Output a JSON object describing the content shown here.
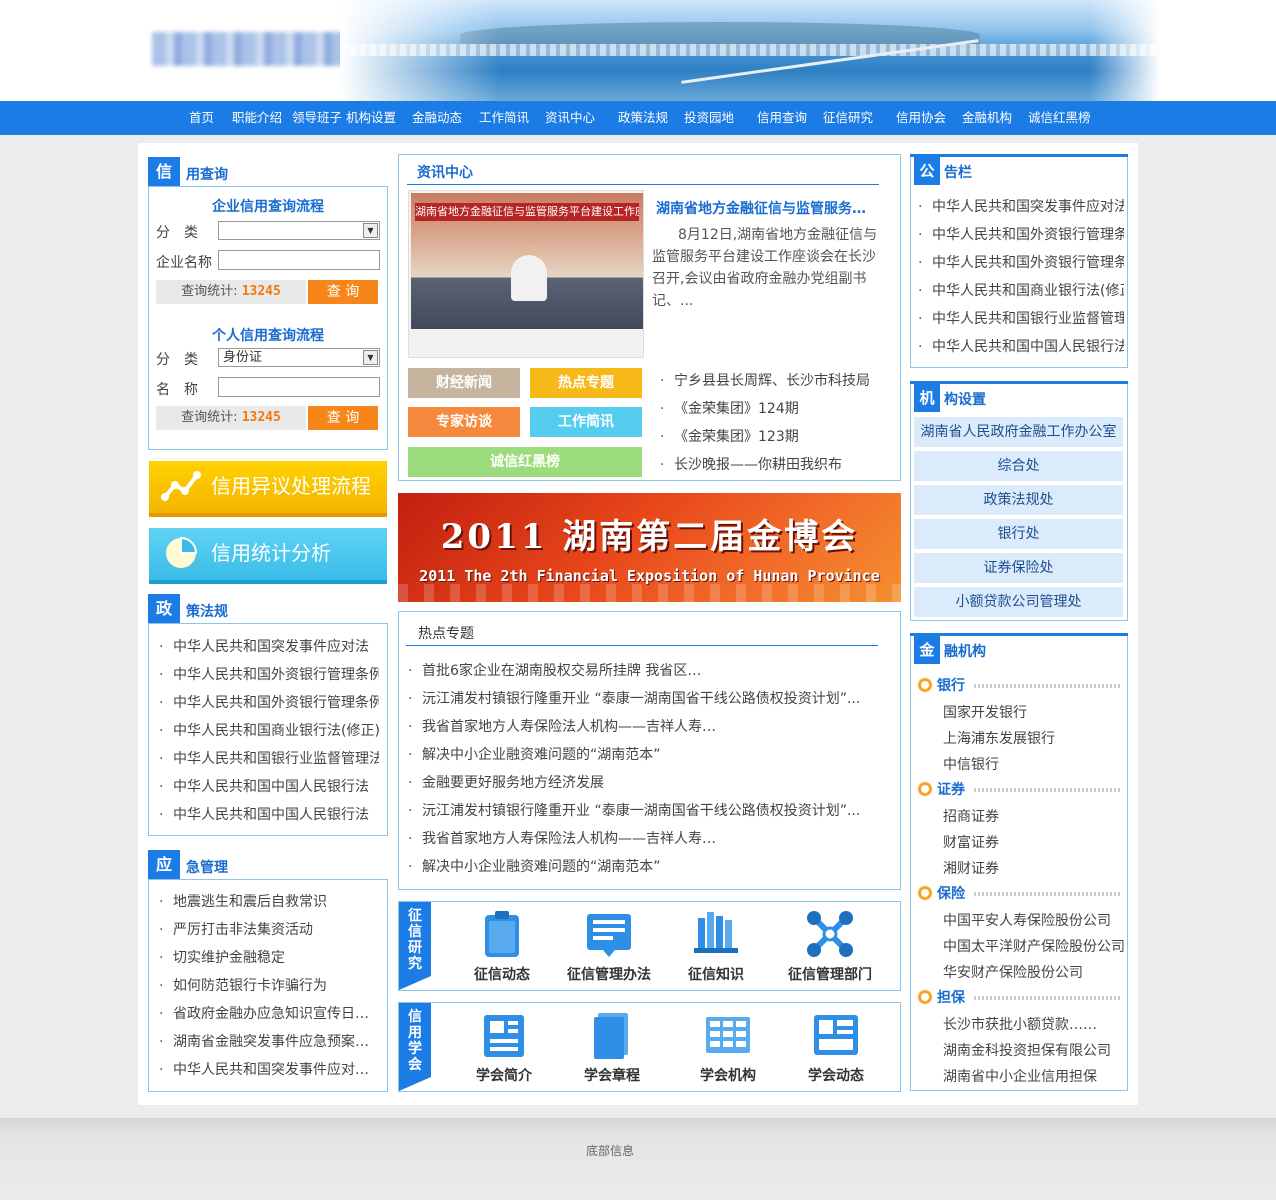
{
  "nav": [
    "首页",
    "职能介绍",
    "领导班子",
    "机构设置",
    "金融动态",
    "工作简讯",
    "资讯中心",
    "政策法规",
    "投资园地",
    "信用查询",
    "征信研究",
    "信用协会",
    "金融机构",
    "诚信红黑榜"
  ],
  "credit_query": {
    "title_first": "信",
    "title_rest": "用查询",
    "enterprise": {
      "title": "企业信用查询流程",
      "category_label": "分　类",
      "category_value": "",
      "name_label": "企业名称",
      "stat_label": "查询统计:",
      "stat_value": "13245",
      "button": "查 询"
    },
    "personal": {
      "title": "个人信用查询流程",
      "category_label": "分　类",
      "category_value": "身份证",
      "name_label": "名　称",
      "stat_label": "查询统计:",
      "stat_value": "13245",
      "button": "查 询"
    }
  },
  "big_buttons": {
    "dispute": "信用异议处理流程",
    "stats": "信用统计分析"
  },
  "policy": {
    "title_first": "政",
    "title_rest": "策法规",
    "items": [
      "中华人民共和国突发事件应对法",
      "中华人民共和国外资银行管理条例",
      "中华人民共和国外资银行管理条例",
      "中华人民共和国商业银行法(修正)",
      "中华人民共和国银行业监督管理法",
      "中华人民共和国中国人民银行法",
      "中华人民共和国中国人民银行法"
    ]
  },
  "emergency": {
    "title_first": "应",
    "title_rest": "急管理",
    "items": [
      "地震逃生和震后自救常识",
      "严厉打击非法集资活动",
      "切实维护金融稳定",
      "如何防范银行卡诈骗行为",
      "省政府金融办应急知识宣传日…",
      "湖南省金融突发事件应急预案…",
      "中华人民共和国突发事件应对…"
    ]
  },
  "news_center": {
    "tab": "资讯中心",
    "image_banner": "湖南省地方金融征信与监管服务平台建设工作座谈会",
    "headline": "湖南省地方金融征信与监管服务…",
    "summary": "8月12日,湖南省地方金融征信与监管服务平台建设工作座谈会在长沙召开,会议由省政府金融办党组副书记、...",
    "tags": [
      "财经新闻",
      "热点专题",
      "专家访谈",
      "工作简讯",
      "诚信红黑榜"
    ],
    "list": [
      "宁乡县县长周辉、长沙市科技局",
      "《金荣集团》124期",
      "《金荣集团》123期",
      "长沙晚报——你耕田我织布"
    ]
  },
  "expo": {
    "title": "2011 湖南第二届金博会",
    "subtitle": "2011 The 2th Financial Exposition of Hunan Province"
  },
  "hot_topics": {
    "tab": "热点专题",
    "items": [
      "首批6家企业在湖南股权交易所挂牌 我省区…",
      "沅江浦发村镇银行隆重开业 “泰康一湖南国省干线公路债权投资计划”...",
      "我省首家地方人寿保险法人机构——吉祥人寿…",
      "解决中小企业融资难问题的“湖南范本”",
      "金融要更好服务地方经济发展",
      "沅江浦发村镇银行隆重开业 “泰康一湖南国省干线公路债权投资计划”...",
      "我省首家地方人寿保险法人机构——吉祥人寿…",
      "解决中小企业融资难问题的“湖南范本”"
    ]
  },
  "credit_research": {
    "label": "征信研究",
    "items": [
      "征信动态",
      "征信管理办法",
      "征信知识",
      "征信管理部门"
    ]
  },
  "credit_assoc": {
    "label": "信用学会",
    "items": [
      "学会简介",
      "学会章程",
      "学会机构",
      "学会动态"
    ]
  },
  "bulletin": {
    "title_first": "公",
    "title_rest": "告栏",
    "items": [
      "中华人民共和国突发事件应对法",
      "中华人民共和国外资银行管理条例",
      "中华人民共和国外资银行管理条例",
      "中华人民共和国商业银行法(修正)",
      "中华人民共和国银行业监督管理法",
      "中华人民共和国中国人民银行法"
    ]
  },
  "org": {
    "title_first": "机",
    "title_rest": "构设置",
    "items": [
      "湖南省人民政府金融工作办公室",
      "综合处",
      "政策法规处",
      "银行处",
      "证券保险处",
      "小额贷款公司管理处"
    ]
  },
  "fin": {
    "title_first": "金",
    "title_rest": "融机构",
    "categories": [
      {
        "name": "银行",
        "items": [
          "国家开发银行",
          "上海浦东发展银行",
          "中信银行"
        ]
      },
      {
        "name": "证券",
        "items": [
          "招商证券",
          "财富证券",
          "湘财证券"
        ]
      },
      {
        "name": "保险",
        "items": [
          "中国平安人寿保险股份公司",
          "中国太平洋财产保险股份公司",
          "华安财产保险股份公司"
        ]
      },
      {
        "name": "担保",
        "items": [
          "长沙市获批小额贷款……",
          "湖南金科投资担保有限公司",
          "湖南省中小企业信用担保"
        ]
      }
    ]
  },
  "footer": "底部信息",
  "colors": {
    "nav": "#1c7ce6",
    "accent_orange": "#f7861a",
    "title_blue": "#1a6cd0",
    "org_bg": "#dbebfb"
  },
  "icons": [
    "chart-line-icon",
    "pie-chart-icon",
    "clipboard-icon",
    "document-icon",
    "books-icon",
    "network-icon",
    "id-card-icon",
    "notebook-icon",
    "grid-table-icon",
    "dashboard-icon"
  ]
}
